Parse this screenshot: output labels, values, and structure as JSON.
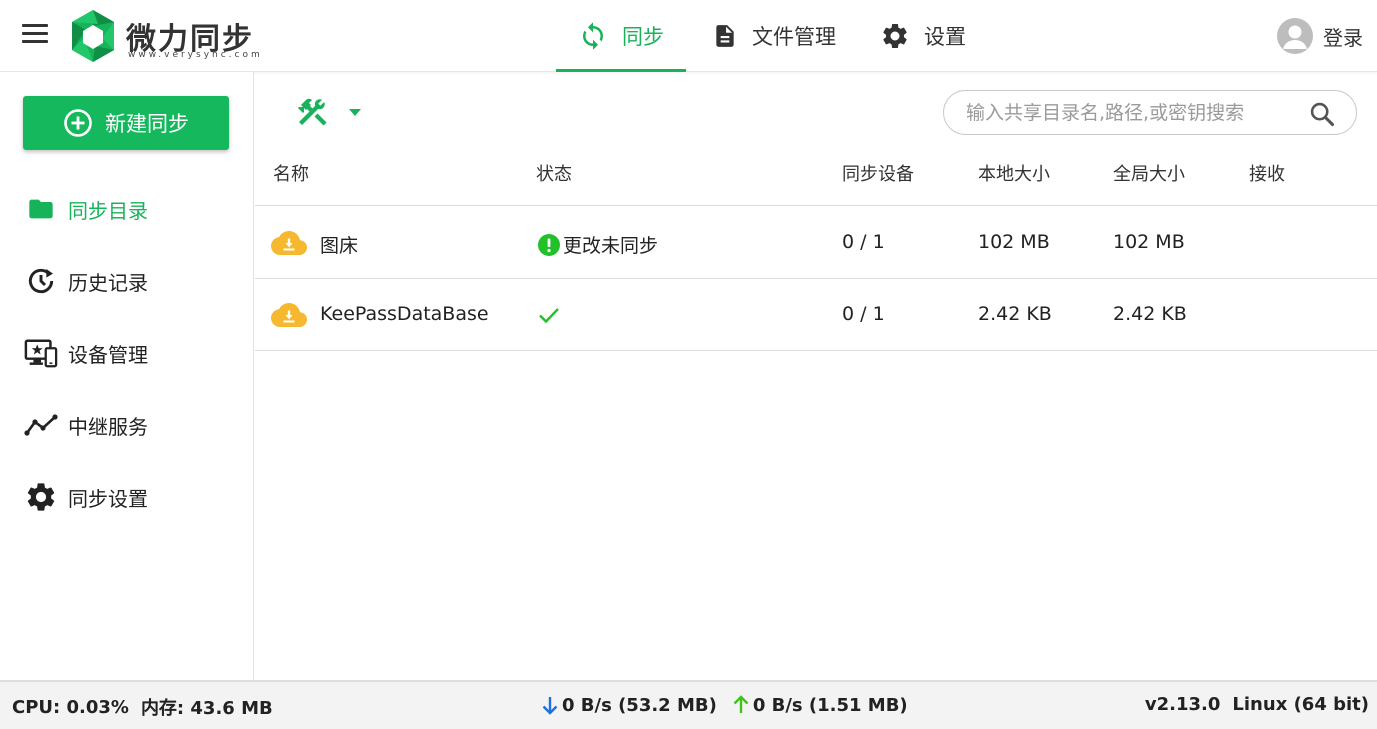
{
  "app": {
    "logo_text": "微力同步",
    "logo_sub": "www.verysync.com",
    "brand_color": "#17b35a"
  },
  "topnav": {
    "items": [
      {
        "label": "同步",
        "icon": "sync-icon",
        "active": true
      },
      {
        "label": "文件管理",
        "icon": "document-icon",
        "active": false
      },
      {
        "label": "设置",
        "icon": "gear-icon",
        "active": false
      }
    ],
    "login_label": "登录"
  },
  "sidebar": {
    "new_sync_label": "新建同步",
    "items": [
      {
        "label": "同步目录",
        "icon": "folder-icon",
        "active": true
      },
      {
        "label": "历史记录",
        "icon": "history-icon",
        "active": false
      },
      {
        "label": "设备管理",
        "icon": "devices-icon",
        "active": false
      },
      {
        "label": "中继服务",
        "icon": "relay-line-icon",
        "active": false
      },
      {
        "label": "同步设置",
        "icon": "gear-icon",
        "active": false
      }
    ]
  },
  "search": {
    "placeholder": "输入共享目录名,路径,或密钥搜索"
  },
  "table": {
    "headers": {
      "name": "名称",
      "status": "状态",
      "devices": "同步设备",
      "local_size": "本地大小",
      "global_size": "全局大小",
      "receive": "接收"
    },
    "rows": [
      {
        "name": "图床",
        "status": "更改未同步",
        "status_type": "warning",
        "devices": "0 / 1",
        "local_size": "102 MB",
        "global_size": "102 MB"
      },
      {
        "name": "KeePassDataBase",
        "status": "",
        "status_type": "ok",
        "devices": "0 / 1",
        "local_size": "2.42 KB",
        "global_size": "2.42 KB"
      }
    ]
  },
  "statusbar": {
    "cpu": "CPU: 0.03%",
    "memory": "内存: 43.6 MB",
    "download": "0 B/s (53.2 MB)",
    "upload": "0 B/s (1.51 MB)",
    "version": "v2.13.0",
    "os": "Linux (64 bit)"
  }
}
